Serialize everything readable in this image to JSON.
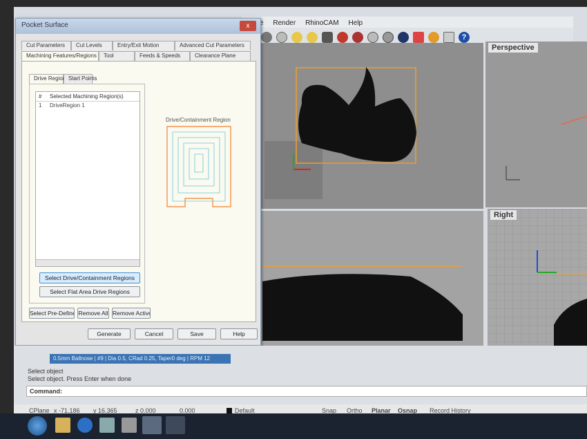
{
  "app": {
    "menu": [
      "alyze",
      "Render",
      "RhinoCAM",
      "Help"
    ],
    "toolbar_icons": [
      "layer-icon",
      "car-icon",
      "circle-icon",
      "bulb-icon",
      "bulb-icon",
      "lock-icon",
      "brush-icon",
      "sphere-icon",
      "sphere-icon",
      "sphere-icon",
      "sphere-icon",
      "arrow-icon",
      "flower-icon",
      "clip-icon",
      "help-icon"
    ],
    "viewports": {
      "perspective": "Perspective",
      "right": "Right"
    }
  },
  "dialog": {
    "title": "Pocket Surface",
    "close": "x",
    "tabs_row1": [
      "Cut Parameters",
      "Cut Levels",
      "Entry/Exit Motion",
      "Advanced Cut Parameters"
    ],
    "tabs_row2": [
      "Machining Features/Regions",
      "Tool",
      "Feeds & Speeds",
      "Clearance Plane"
    ],
    "subtabs": [
      "Drive Regions",
      "Start Points"
    ],
    "list_headers": [
      "#",
      "Selected Machining Region(s)"
    ],
    "list_rows": [
      {
        "num": "1",
        "name": "DriveRegion 1"
      }
    ],
    "preview_label": "Drive/Containment Region",
    "buttons": {
      "select_drive": "Select Drive/Containment Regions",
      "select_flat": "Select Flat Area Drive Regions",
      "select_predefined": "Select Pre-Defined",
      "remove_all": "Remove All",
      "remove_active": "Remove Active",
      "generate": "Generate",
      "cancel": "Cancel",
      "save": "Save",
      "help": "Help"
    }
  },
  "command": {
    "tool_info": "0.5mm Ballnose | #9 | Dia 0.5, CRad 0.25, Taper0 deg | RPM 12",
    "history": [
      "Select object",
      "Select object. Press Enter when done"
    ],
    "prompt": "Command:"
  },
  "status": {
    "cplane": "CPlane",
    "x": "x -71.186",
    "y": "y 16.365",
    "z": "z 0.000",
    "extra": "0.000",
    "layer": "Default",
    "toggles": [
      "Snap",
      "Ortho",
      "Planar",
      "Osnap",
      "Record History"
    ]
  }
}
